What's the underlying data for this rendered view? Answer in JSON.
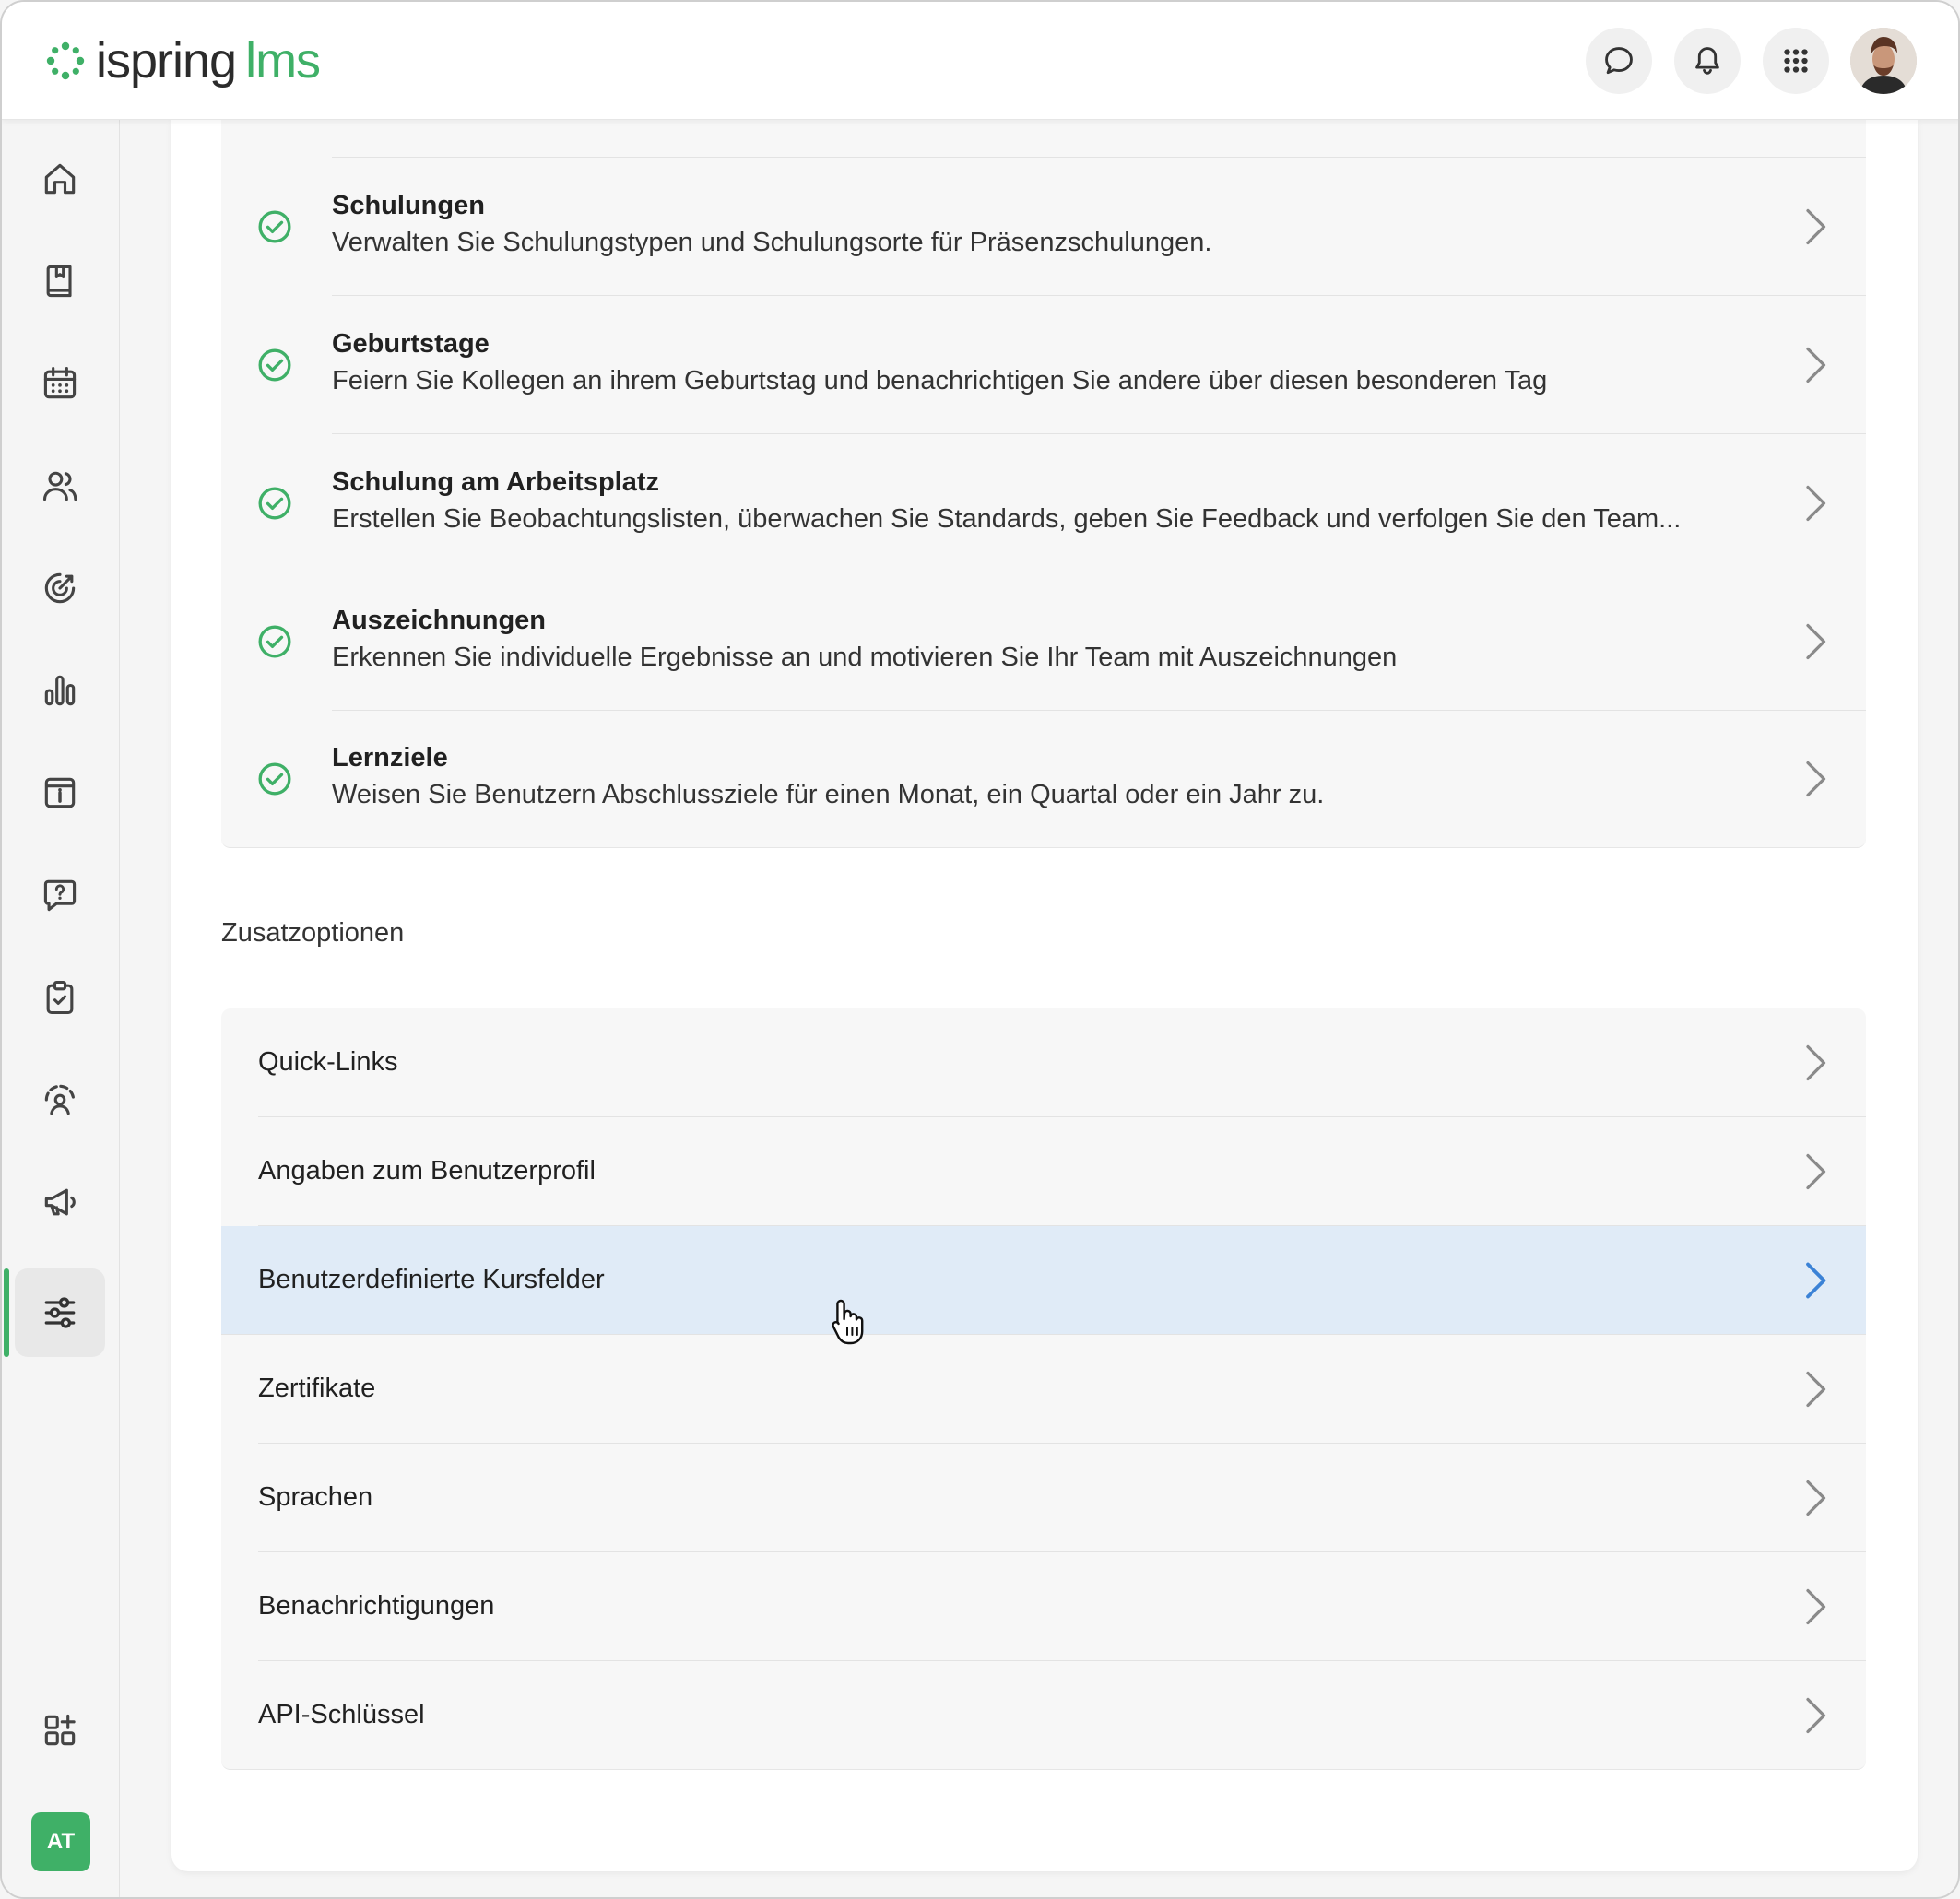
{
  "brand": {
    "part1": "ispring",
    "part2": "lms"
  },
  "colors": {
    "accent": "#3fb067",
    "hover_row": "#e0ebf7",
    "chevron_active": "#3b82d6"
  },
  "header": {
    "icons": [
      "chat-icon",
      "bell-icon",
      "apps-grid-icon"
    ],
    "avatar": "user-avatar"
  },
  "sidebar": {
    "items": [
      "home-icon",
      "book-icon",
      "calendar-icon",
      "users-icon",
      "target-icon",
      "chart-icon",
      "info-board-icon",
      "help-chat-icon",
      "clipboard-check-icon",
      "user-support-icon",
      "megaphone-icon",
      "settings-sliders-icon"
    ],
    "active": "settings-sliders-icon",
    "bottom_icon": "add-app-icon",
    "user_initials": "AT"
  },
  "features": [
    {
      "title": "Schulungen",
      "description": "Verwalten Sie Schulungstypen und Schulungsorte für Präsenzschulungen."
    },
    {
      "title": "Geburtstage",
      "description": "Feiern Sie Kollegen an ihrem Geburtstag und benachrichtigen Sie andere über diesen besonderen Tag"
    },
    {
      "title": "Schulung am Arbeitsplatz",
      "description": "Erstellen Sie Beobachtungslisten, überwachen Sie Standards, geben Sie Feedback und verfolgen Sie den Team..."
    },
    {
      "title": "Auszeichnungen",
      "description": "Erkennen Sie individuelle Ergebnisse an und motivieren Sie Ihr Team mit Auszeichnungen"
    },
    {
      "title": "Lernziele",
      "description": "Weisen Sie Benutzern Abschlussziele für einen Monat, ein Quartal oder ein Jahr zu."
    }
  ],
  "extras": {
    "title": "Zusatzoptionen",
    "items": [
      "Quick-Links",
      "Angaben zum Benutzerprofil",
      "Benutzerdefinierte Kursfelder",
      "Zertifikate",
      "Sprachen",
      "Benachrichtigungen",
      "API-Schlüssel"
    ],
    "hovered": "Benutzerdefinierte Kursfelder"
  }
}
